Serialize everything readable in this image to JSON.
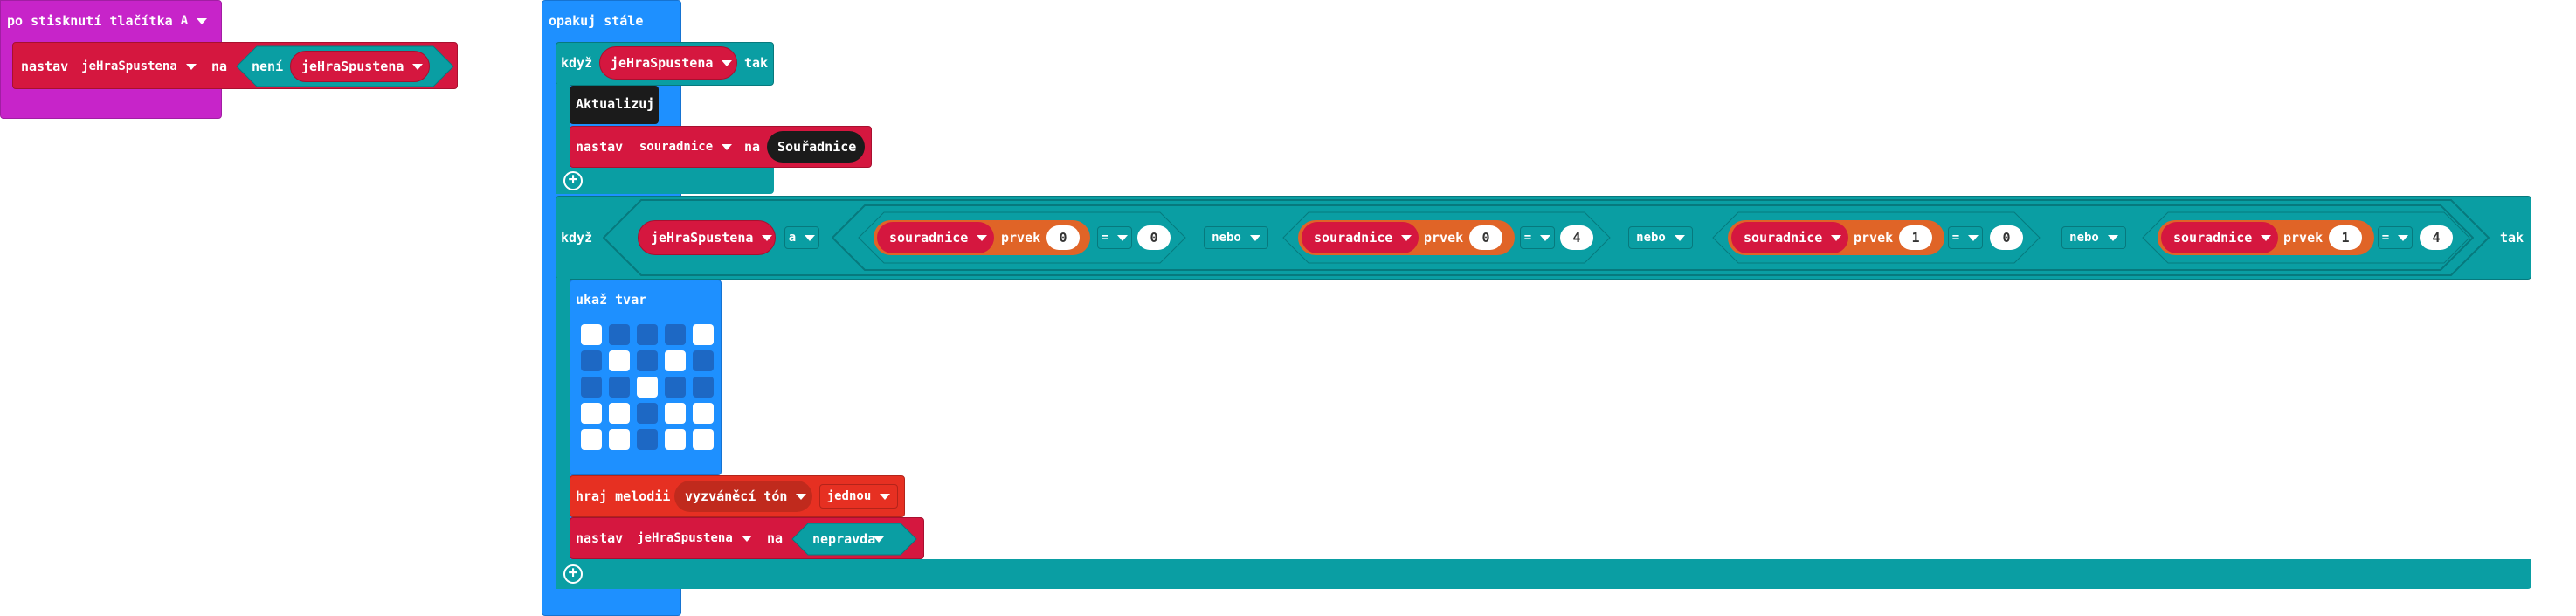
{
  "event_block": {
    "label": "po stisknutí tlačítka",
    "button_value": "A",
    "set_label": "nastav",
    "variable": "jeHraSpustena",
    "to_label": "na",
    "not_label": "není",
    "not_variable": "jeHraSpustena"
  },
  "forever_block": {
    "label": "opakuj stále",
    "if1": {
      "if_label": "když",
      "condition_variable": "jeHraSpustena",
      "then_label": "tak",
      "update_label": "Aktualizuj",
      "set_label": "nastav",
      "set_variable": "souradnice",
      "to_label": "na",
      "set_value": "Souřadnice"
    },
    "if2": {
      "if_label": "když",
      "condition_variable": "jeHraSpustena",
      "and_label": "a",
      "then_label": "tak",
      "comparisons": [
        {
          "variable": "souradnice",
          "item_label": "prvek",
          "index": "0",
          "op": "=",
          "value": "0"
        },
        {
          "variable": "souradnice",
          "item_label": "prvek",
          "index": "0",
          "op": "=",
          "value": "4"
        },
        {
          "variable": "souradnice",
          "item_label": "prvek",
          "index": "1",
          "op": "=",
          "value": "0"
        },
        {
          "variable": "souradnice",
          "item_label": "prvek",
          "index": "1",
          "op": "=",
          "value": "4"
        }
      ],
      "or_labels": [
        "nebo",
        "nebo",
        "nebo"
      ],
      "show_label": "ukaž tvar",
      "led_grid": [
        [
          1,
          0,
          0,
          0,
          1
        ],
        [
          0,
          1,
          0,
          1,
          0
        ],
        [
          0,
          0,
          1,
          0,
          0
        ],
        [
          1,
          1,
          0,
          1,
          1
        ],
        [
          1,
          1,
          0,
          1,
          1
        ]
      ],
      "play_label": "hraj melodii",
      "melody": "vyzváněcí tón",
      "repeat": "jednou",
      "set_label": "nastav",
      "set_variable": "jeHraSpustena",
      "to_label": "na",
      "set_value": "nepravda"
    }
  },
  "colors": {
    "events": "#c724c9",
    "variables": "#d5173f",
    "logic": "#0a9ea3",
    "basic": "#1e90ff",
    "music": "#e63022",
    "arrays": "#e06427",
    "function": "#1b1b1b"
  }
}
